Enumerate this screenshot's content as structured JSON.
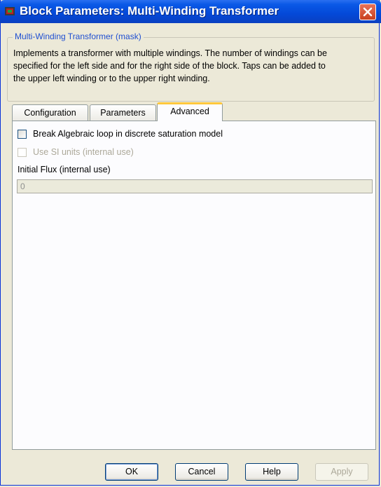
{
  "window": {
    "title": "Block Parameters: Multi-Winding Transformer"
  },
  "mask": {
    "group_title": "Multi-Winding Transformer (mask)",
    "description_lines": [
      "Implements a transformer with multiple windings. The number of windings can be",
      "specified for the left side and for the right side of the block. Taps can be added to",
      "the upper left winding or to the upper right winding."
    ]
  },
  "tabs": [
    {
      "label": "Configuration",
      "active": false
    },
    {
      "label": "Parameters",
      "active": false
    },
    {
      "label": "Advanced",
      "active": true
    }
  ],
  "advanced": {
    "break_loop": {
      "label": "Break Algebraic loop in discrete saturation model",
      "checked": false,
      "enabled": true
    },
    "si_units": {
      "label": "Use SI units (internal use)",
      "checked": false,
      "enabled": false
    },
    "initial_flux": {
      "label": "Initial Flux (internal use)",
      "value": "0",
      "enabled": false
    }
  },
  "buttons": {
    "ok": "OK",
    "cancel": "Cancel",
    "help": "Help",
    "apply": "Apply"
  }
}
